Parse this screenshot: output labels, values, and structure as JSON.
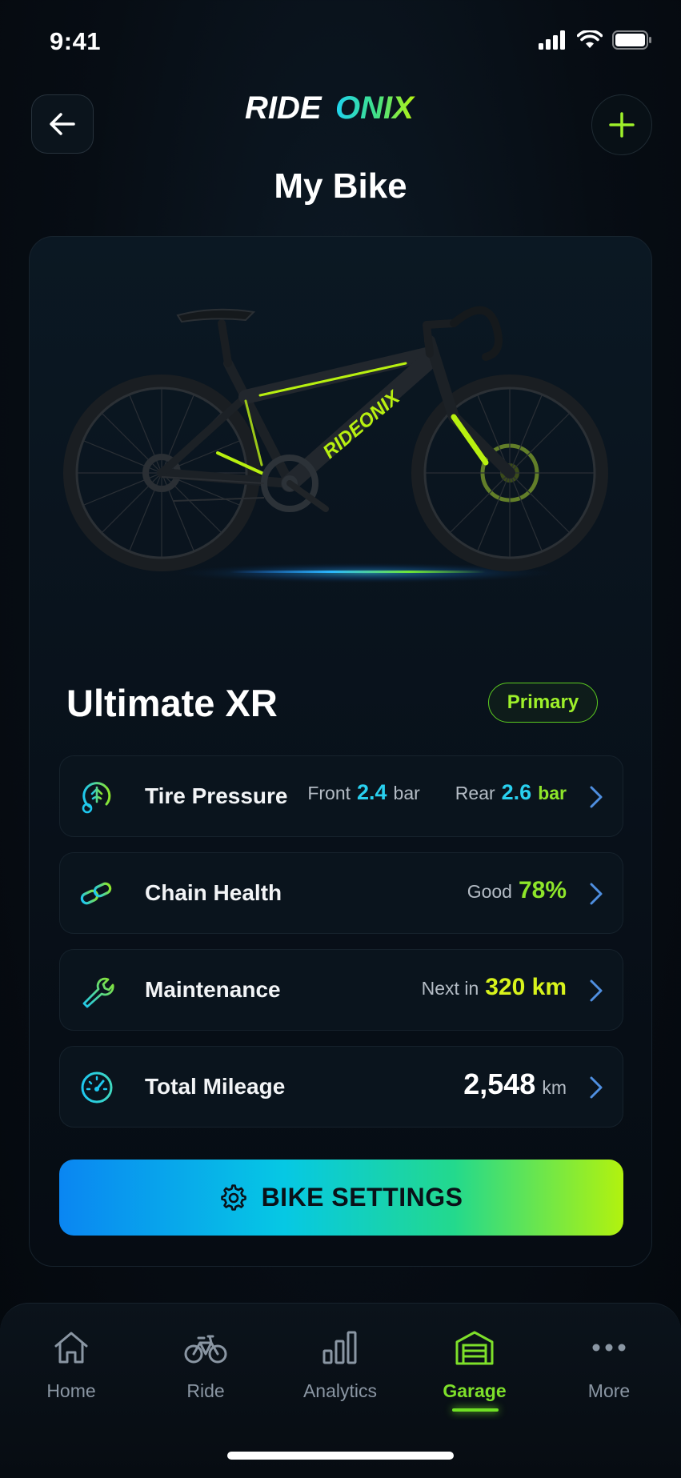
{
  "status_bar": {
    "time": "9:41"
  },
  "header": {
    "brand_part1": "RIDE",
    "brand_part2": "ONIX",
    "title": "My Bike"
  },
  "bike": {
    "name": "Ultimate XR",
    "badge": "Primary",
    "frame_brand": "RIDEONIX"
  },
  "stats": {
    "tire": {
      "label": "Tire Pressure",
      "front_label": "Front",
      "front_value": "2.4",
      "front_unit": "bar",
      "rear_label": "Rear",
      "rear_value": "2.6",
      "rear_unit": "bar"
    },
    "chain": {
      "label": "Chain Health",
      "status": "Good",
      "value": "78%"
    },
    "maintenance": {
      "label": "Maintenance",
      "prefix": "Next in",
      "value": "320 km"
    },
    "mileage": {
      "label": "Total Mileage",
      "value": "2,548",
      "unit": "km"
    }
  },
  "settings_button": {
    "label": "BIKE SETTINGS"
  },
  "tabbar": {
    "items": [
      {
        "label": "Home",
        "icon": "home-icon"
      },
      {
        "label": "Ride",
        "icon": "bicycle-icon"
      },
      {
        "label": "Analytics",
        "icon": "bar-chart-icon"
      },
      {
        "label": "Garage",
        "icon": "garage-icon"
      },
      {
        "label": "More",
        "icon": "more-dots-icon"
      }
    ],
    "active": "Garage"
  },
  "colors": {
    "accent_green": "#8ee62a",
    "accent_cyan": "#29d0ef",
    "accent_yellow": "#d8f31c",
    "background": "#070d14"
  }
}
